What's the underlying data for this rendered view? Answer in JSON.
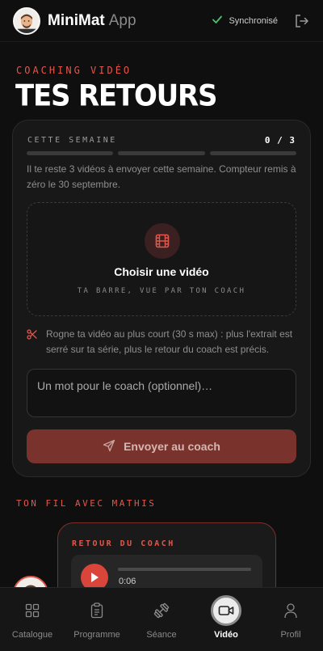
{
  "header": {
    "brand": "MiniMat",
    "suffix": "App",
    "sync_status": "Synchronisé",
    "icons": {
      "avatar": "user-avatar-icon",
      "sync": "check-icon",
      "logout": "logout-icon"
    }
  },
  "page": {
    "eyebrow": "COACHING VIDÉO",
    "title": "TES RETOURS"
  },
  "week": {
    "label": "CETTE SEMAINE",
    "count": "0 / 3",
    "used": 0,
    "total": 3,
    "quota_text": "Il te reste 3 vidéos à envoyer cette semaine. Compteur remis à zéro le 30 septembre."
  },
  "upload": {
    "title": "Choisir une vidéo",
    "subtitle": "TA BARRE, VUE PAR TON COACH",
    "icon": "film-icon"
  },
  "tip": {
    "icon": "scissors-icon",
    "text": "Rogne ta vidéo au plus court (30 s max) : plus l'extrait est serré sur ta série, plus le retour du coach est précis."
  },
  "note": {
    "placeholder": "Un mot pour le coach (optionnel)…"
  },
  "send": {
    "label": "Envoyer au coach",
    "icon": "send-icon"
  },
  "thread": {
    "label": "TON FIL AVEC MATHIS",
    "message": {
      "label": "RETOUR DU COACH",
      "time": "0:06",
      "progress": 0
    }
  },
  "nav": {
    "items": [
      {
        "label": "Catalogue",
        "icon": "grid-icon",
        "active": false
      },
      {
        "label": "Programme",
        "icon": "clipboard-icon",
        "active": false
      },
      {
        "label": "Séance",
        "icon": "dumbbell-icon",
        "active": false
      },
      {
        "label": "Vidéo",
        "icon": "video-camera-icon",
        "active": true
      },
      {
        "label": "Profil",
        "icon": "user-icon",
        "active": false
      }
    ]
  },
  "colors": {
    "accent": "#e2574c",
    "background": "#0f0f0f",
    "card": "#181818",
    "send_button": "#7a322c",
    "sync_check": "#4cc36b"
  }
}
